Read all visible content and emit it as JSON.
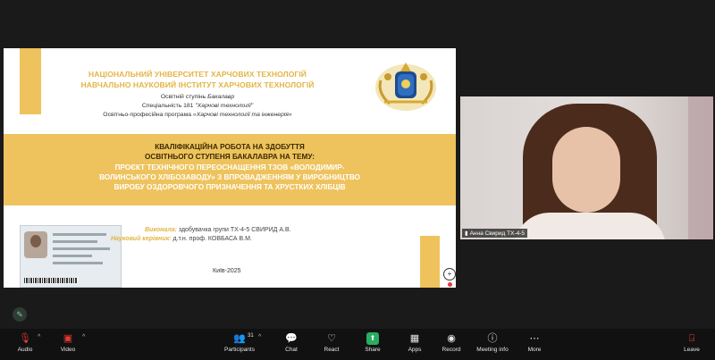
{
  "slide": {
    "university_line1": "НАЦІОНАЛЬНИЙ УНІВЕРСИТЕТ ХАРЧОВИХ ТЕХНОЛОГІЙ",
    "university_line2": "НАВЧАЛЬНО НАУКОВИЙ ІНСТИТУТ ХАРЧОВИХ ТЕХНОЛОГІЙ",
    "degree_prefix": "Освітній ступінь ",
    "degree_value": "Бакалавр",
    "specialty_prefix": "Спеціальність 181 ",
    "specialty_value": "\"Харчові технології\"",
    "program_prefix": "Освітньо-професійна програма ",
    "program_value": "«Харчові технології та інженерія»",
    "title_line1": "КВАЛІФІКАЦІЙНА РОБОТА НА ЗДОБУТТЯ",
    "title_line2": "ОСВІТНЬОГО СТУПЕНЯ БАКАЛАВРА НА ТЕМУ:",
    "title_line3": "ПРОЄКТ ТЕХНІЧНОГО ПЕРЕОСНАЩЕННЯ ТЗОВ «ВОЛОДИМИР-",
    "title_line4": "ВОЛИНСЬКОГО ХЛІБОЗАВОДУ» З ВПРОВАДЖЕННЯМ У ВИРОБНИЦТВО",
    "title_line5": "ВИРОБУ ОЗДОРОВЧОГО ПРИЗНАЧЕННЯ ТА ХРУСТКИХ ХЛІБЦІВ",
    "performer_label": "Виконала:",
    "performer_value": " здобувачка групи ТХ-4-5 СВИРИД А.В.",
    "advisor_label": "Науковий керівник:",
    "advisor_value": " д.т.н. проф. КОВБАСА В.М.",
    "city_year": "Київ-2025"
  },
  "participant": {
    "name": "Анна Свирид ТХ-4-5"
  },
  "toolbar": {
    "audio": "Audio",
    "video": "Video",
    "participants": "Participants",
    "participants_count": "31",
    "chat": "Chat",
    "react": "React",
    "share": "Share",
    "apps": "Apps",
    "record": "Record",
    "meeting_info": "Meeting info",
    "more": "More",
    "leave": "Leave"
  },
  "colors": {
    "accent_gold": "#eec35d",
    "share_green": "#27ae60",
    "leave_red": "#e53935"
  }
}
